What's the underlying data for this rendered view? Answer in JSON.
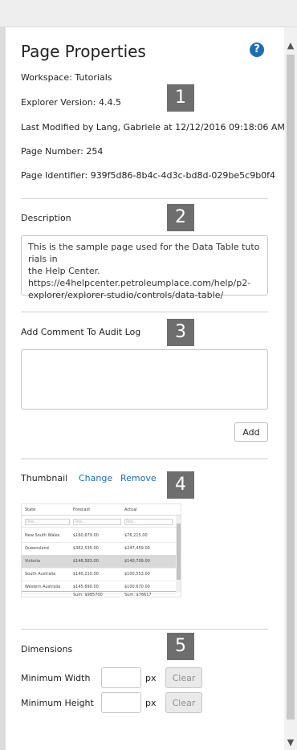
{
  "panel": {
    "title": "Page Properties",
    "help_glyph": "?"
  },
  "info": {
    "workspace": "Workspace: Tutorials",
    "explorer_version": "Explorer Version: 4.4.5",
    "last_modified": "Last Modified by Lang, Gabriele at 12/12/2016 09:18:06 AM",
    "page_number": "Page Number: 254",
    "page_identifier": "Page Identifier: 939f5d86-8b4c-4d3c-bd8d-029be5c9b0f4"
  },
  "callouts": [
    "1",
    "2",
    "3",
    "4",
    "5"
  ],
  "description": {
    "label": "Description",
    "lines": [
      "This is the sample page used for the Data Table tutorials in",
      "the Help Center.",
      "https://e4helpcenter.petroleumplace.com/help/p2-",
      "explorer/explorer-studio/controls/data-table/"
    ]
  },
  "audit": {
    "label": "Add Comment To Audit Log",
    "value": "",
    "add_label": "Add"
  },
  "thumbnail": {
    "label": "Thumbnail",
    "change_label": "Change",
    "remove_label": "Remove",
    "columns": [
      "State",
      "Forecast",
      "Actual"
    ],
    "filter_placeholders": [
      "Filter...",
      "Filter...",
      "Filter..."
    ],
    "rows": [
      [
        "New South Wales",
        "$160,679.00",
        "$76,215.00"
      ],
      [
        "Queensland",
        "$362,535.00",
        "$247,459.00"
      ],
      [
        "Victoria",
        "$146,583.00",
        "$140,709.00"
      ],
      [
        "South Australia",
        "$140,210.00",
        "$100,553.00"
      ],
      [
        "Western Australia",
        "$145,690.00",
        "$100,670.00"
      ]
    ],
    "selected_row": 2,
    "totals": [
      "Sum: $985700",
      "Sum: $76617"
    ]
  },
  "dimensions": {
    "label": "Dimensions",
    "min_width_label": "Minimum Width",
    "min_height_label": "Minimum Height",
    "min_width_value": "",
    "min_height_value": "",
    "unit": "px",
    "clear_label": "Clear"
  },
  "colors": {
    "link": "#1a6fb4",
    "callout_bg": "#6e6e6e"
  },
  "icons": {
    "help": "help-icon",
    "scroll_up": "chevron-up-icon",
    "scroll_down": "chevron-down-icon"
  }
}
